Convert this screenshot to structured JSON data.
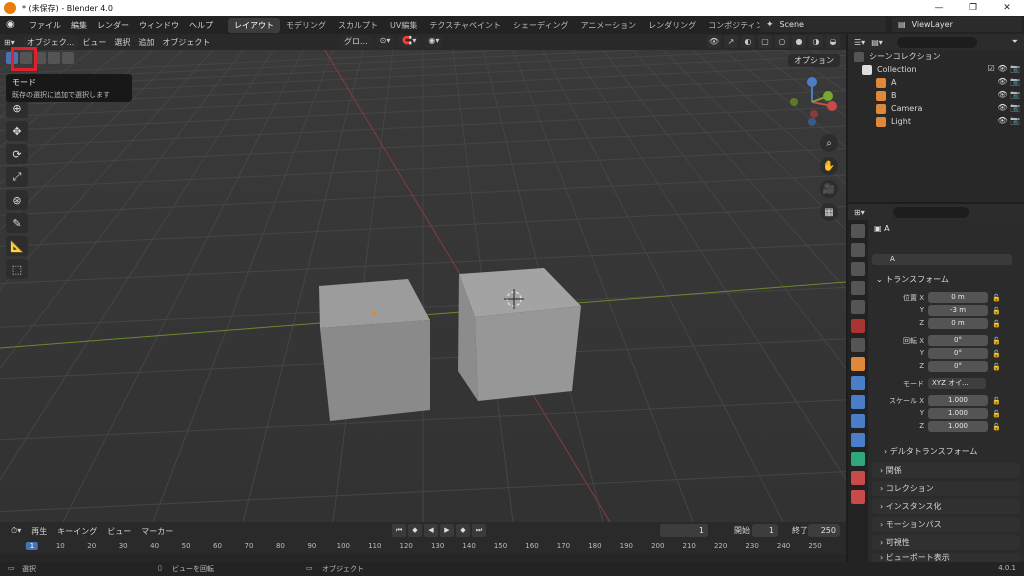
{
  "window": {
    "title": "* (未保存) - Blender 4.0"
  },
  "menu": [
    "ファイル",
    "編集",
    "レンダー",
    "ウィンドウ",
    "ヘルプ"
  ],
  "workspaces": [
    "レイアウト",
    "モデリング",
    "スカルプト",
    "UV編集",
    "テクスチャペイント",
    "シェーディング",
    "アニメーション",
    "レンダリング",
    "コンポジティング"
  ],
  "scene": {
    "name": "Scene",
    "view_layer": "ViewLayer"
  },
  "viewport": {
    "mode": "オブジェク...",
    "menus": [
      "ビュー",
      "選択",
      "追加",
      "オブジェクト"
    ],
    "transform_orientation": "グロ...",
    "options": "オプション",
    "tooltip": {
      "title": "モード",
      "desc": "既存の選択に追加で選択します"
    }
  },
  "outliner": {
    "root": "シーンコレクション",
    "collection": "Collection",
    "items": [
      "A",
      "B",
      "Camera",
      "Light"
    ]
  },
  "properties": {
    "object_name": "A",
    "data_name": "A",
    "transform_title": "トランスフォーム",
    "location_label": "位置 X",
    "rotation_label": "回転 X",
    "scale_label": "スケール X",
    "y": "Y",
    "z": "Z",
    "location": [
      "0 m",
      "-3 m",
      "0 m"
    ],
    "rotation": [
      "0°",
      "0°",
      "0°"
    ],
    "mode_label": "モード",
    "rotation_mode": "XYZ オイ...",
    "scale": [
      "1.000",
      "1.000",
      "1.000"
    ],
    "delta": "デルタトランスフォーム",
    "sections": [
      "関係",
      "コレクション",
      "インスタンス化",
      "モーションパス",
      "可視性",
      "ビューポート表示"
    ]
  },
  "timeline": {
    "menus": [
      "再生",
      "キーイング",
      "ビュー",
      "マーカー"
    ],
    "current_frame": "1",
    "start_label": "開始",
    "start": "1",
    "end_label": "終了",
    "end": "250",
    "ticks": [
      "1",
      "10",
      "20",
      "30",
      "40",
      "50",
      "60",
      "70",
      "80",
      "90",
      "100",
      "110",
      "120",
      "130",
      "140",
      "150",
      "160",
      "170",
      "180",
      "190",
      "200",
      "210",
      "220",
      "230",
      "240",
      "250"
    ]
  },
  "statusbar": {
    "select": "選択",
    "rotate": "ビューを回転",
    "object": "オブジェクト",
    "version": "4.0.1"
  },
  "colors": {
    "accent": "#4772b3",
    "highlight": "#e0202a"
  }
}
